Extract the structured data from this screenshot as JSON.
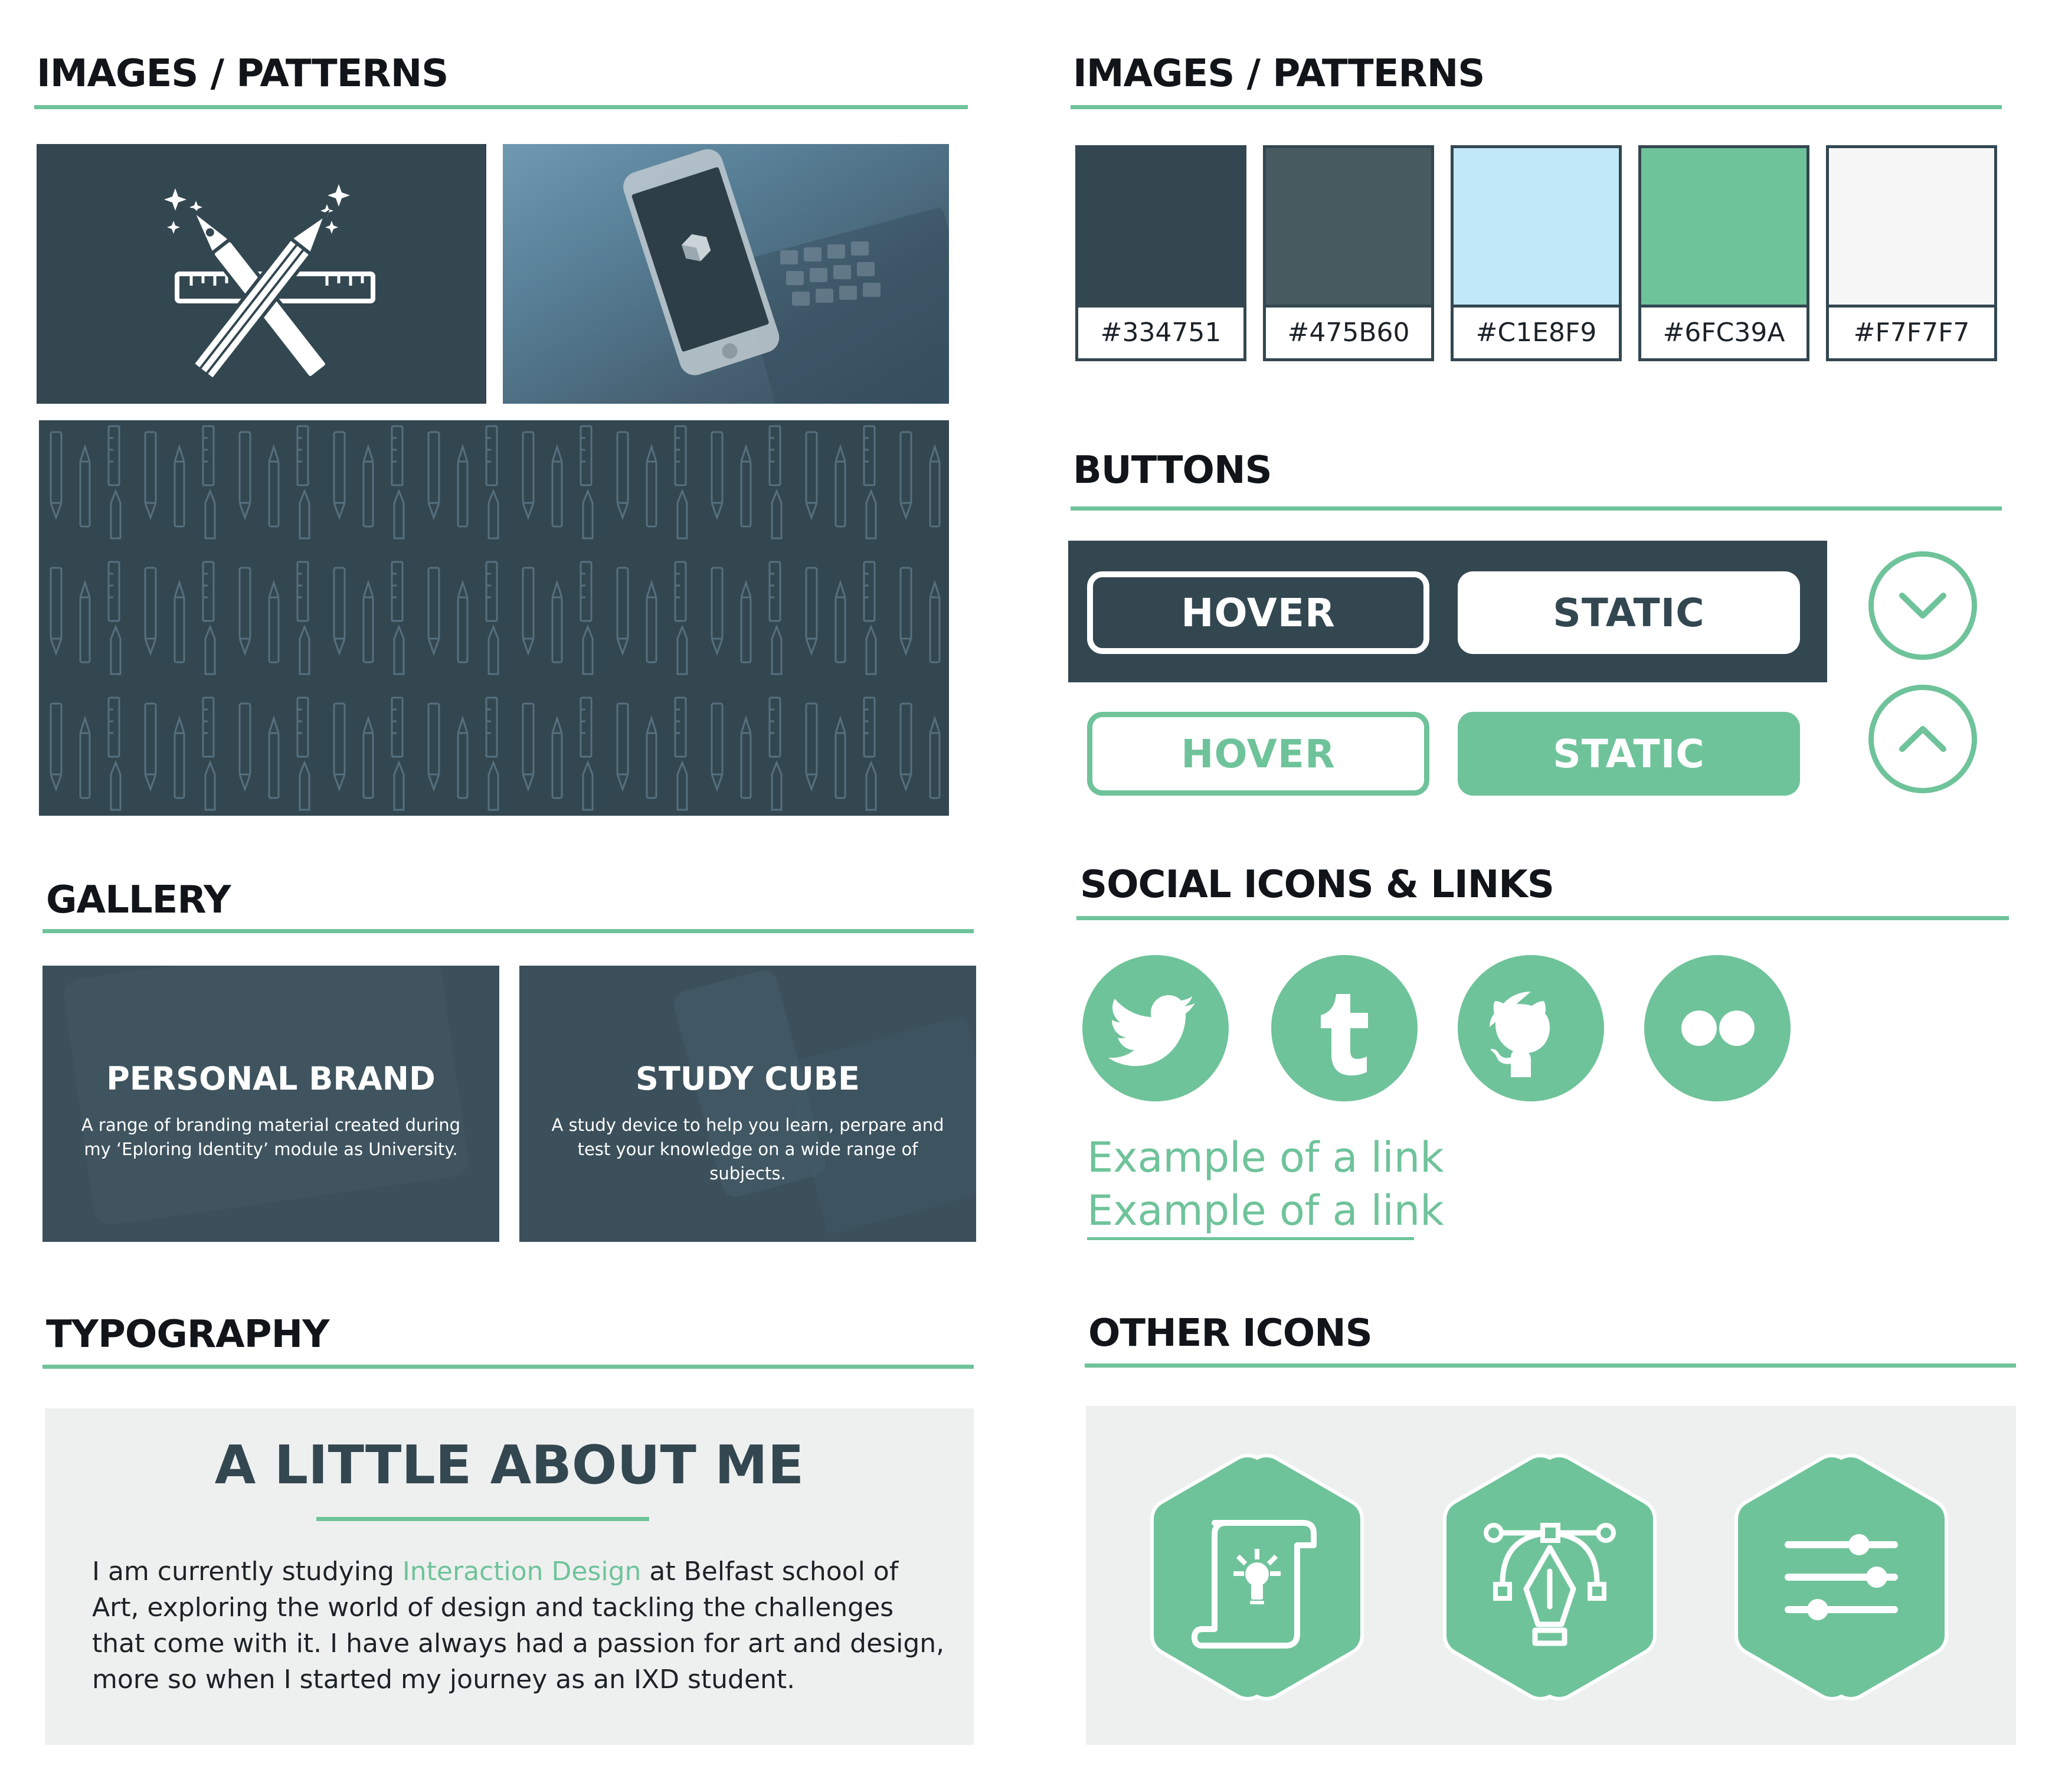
{
  "sections": {
    "images_left": "IMAGES / PATTERNS",
    "images_right": "IMAGES / PATTERNS",
    "buttons": "BUTTONS",
    "social": "SOCIAL ICONS & LINKS",
    "gallery": "GALLERY",
    "typography": "TYPOGRAPHY",
    "other_icons": "OTHER ICONS"
  },
  "colors": {
    "accent": "#6FC39A",
    "dark": "#334751",
    "light_gray": "#EEF0EF"
  },
  "icons": {
    "hero": "pen-pencil-ruler-icon",
    "phone_screen": "study-cube-logo-icon",
    "social": [
      "twitter-icon",
      "tumblr-icon",
      "github-icon",
      "flickr-icon"
    ],
    "other": [
      "scroll-lightbulb-icon",
      "vector-pen-icon",
      "sliders-icon"
    ],
    "circles": [
      "chevron-down-icon",
      "chevron-up-icon"
    ]
  },
  "swatches": [
    {
      "code": "#334751",
      "color": "#334751"
    },
    {
      "code": "#475B60",
      "color": "#475B60"
    },
    {
      "code": "#C1E8F9",
      "color": "#C1E8F9"
    },
    {
      "code": "#6FC39A",
      "color": "#6FC39A"
    },
    {
      "code": "#F7F7F7",
      "color": "#F7F7F7"
    }
  ],
  "buttons": {
    "hover_dark": "HOVER",
    "static_dark": "STATIC",
    "hover_green": "HOVER",
    "static_green": "STATIC"
  },
  "links": [
    "Example of a link",
    "Example of a link"
  ],
  "gallery": [
    {
      "title": "PERSONAL BRAND",
      "desc_line1": "A range of branding material created during",
      "desc_line2": "my ‘Eploring Identity’ module as University."
    },
    {
      "title": "STUDY CUBE",
      "desc_line1": "A study device to help you learn, perpare and",
      "desc_line2": "test your knowledge on a wide range of subjects."
    }
  ],
  "about": {
    "title": "A LITTLE ABOUT ME",
    "text_before": "I am currently studying ",
    "text_accent": "Interaction Design",
    "text_after": " at Belfast school of Art, exploring the world of design and tackling the challenges that come with it. I have always had a passion for art and design, more so when I started my journey as an IXD student."
  }
}
